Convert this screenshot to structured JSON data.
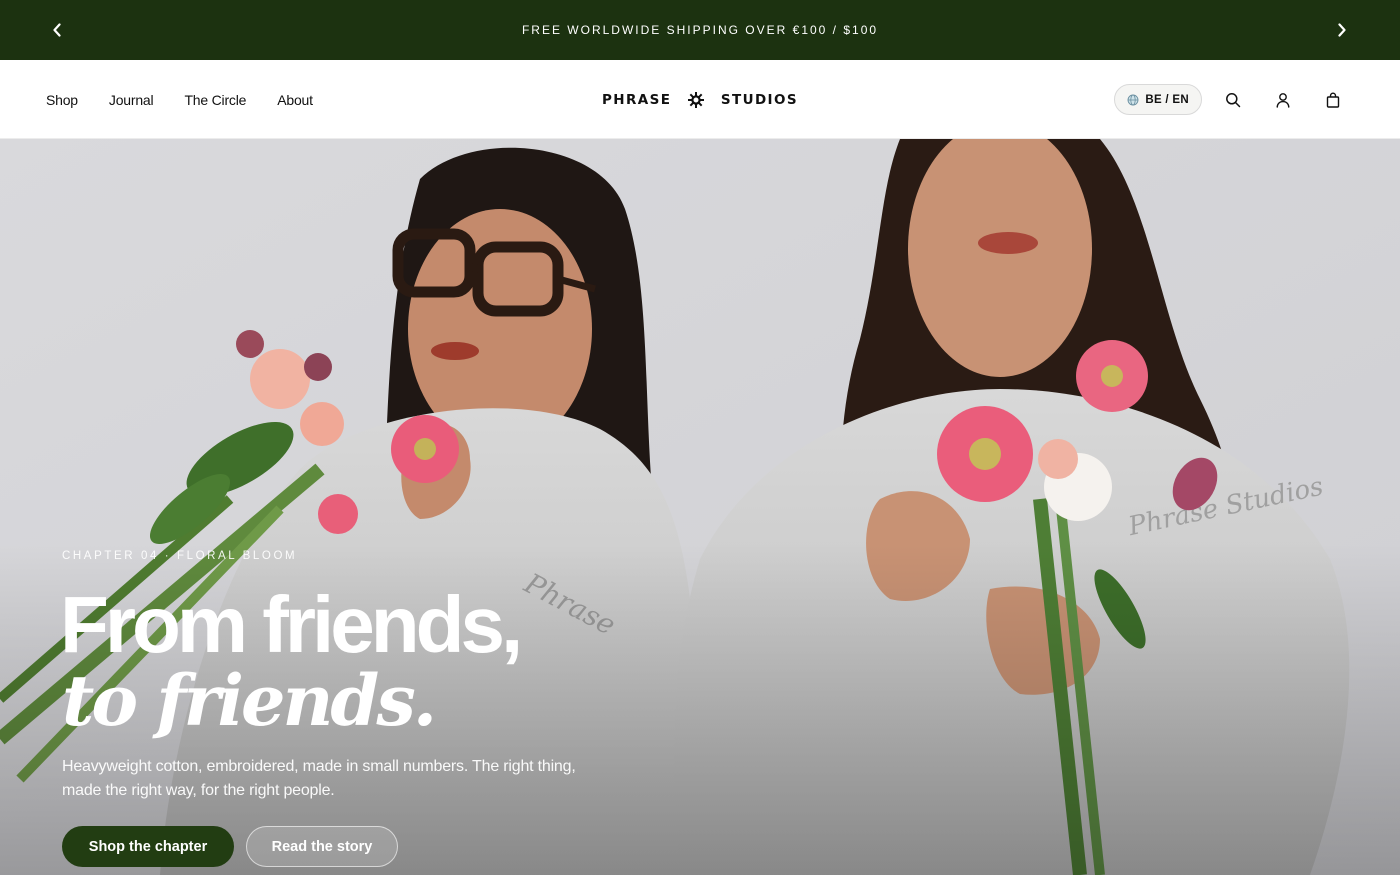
{
  "announcement": {
    "text": "FREE WORLDWIDE SHIPPING OVER €100 / $100",
    "prev_icon": "chevron-left-icon",
    "next_icon": "chevron-right-icon"
  },
  "header": {
    "nav": [
      "Shop",
      "Journal",
      "The Circle",
      "About"
    ],
    "logo": {
      "left": "PHRASE",
      "right": "STUDIOS",
      "mark_icon": "sun-gear-icon"
    },
    "locale": "BE / EN",
    "icons": [
      "globe-icon",
      "search-icon",
      "account-icon",
      "bag-icon"
    ]
  },
  "hero": {
    "eyebrow": "CHAPTER 04 · FLORAL BLOOM",
    "headline_line1": "From friends,",
    "headline_line2": "to friends.",
    "subcopy": "Heavyweight cotton, embroidered, made in small numbers. The right thing, made the right way, for the right people.",
    "primary_cta": "Shop the chapter",
    "secondary_cta": "Read the story"
  },
  "colors": {
    "announcement_bg": "#1c3210",
    "primary_button_bg": "#223d12",
    "hero_text": "#ffffff"
  }
}
